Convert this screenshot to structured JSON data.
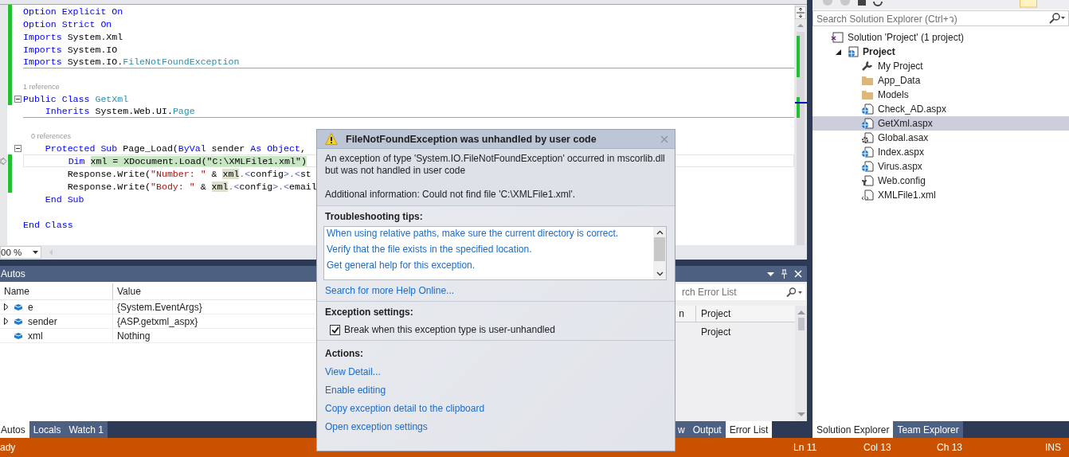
{
  "editor": {
    "lines": [
      {
        "kind": "code",
        "changed": true,
        "segments": [
          {
            "kind": "keyword",
            "text": "Option Explicit On"
          }
        ]
      },
      {
        "kind": "code",
        "changed": true,
        "segments": [
          {
            "kind": "keyword",
            "text": "Option Strict On"
          }
        ]
      },
      {
        "kind": "code",
        "changed": true,
        "segments": [
          {
            "kind": "keyword",
            "text": "Imports"
          },
          {
            "kind": "plain",
            "text": " System.Xml"
          }
        ]
      },
      {
        "kind": "code",
        "changed": true,
        "segments": [
          {
            "kind": "keyword",
            "text": "Imports"
          },
          {
            "kind": "plain",
            "text": " System.IO"
          }
        ]
      },
      {
        "kind": "code",
        "changed": true,
        "separator_below": true,
        "segments": [
          {
            "kind": "keyword",
            "text": "Imports"
          },
          {
            "kind": "plain",
            "text": " System.IO."
          },
          {
            "kind": "type",
            "text": "FileNotFoundException"
          }
        ]
      },
      {
        "kind": "blank",
        "changed": true
      },
      {
        "kind": "codelens",
        "changed": true,
        "text": "1 reference"
      },
      {
        "kind": "code",
        "changed": true,
        "collapsible": true,
        "segments": [
          {
            "kind": "keyword",
            "text": "Public Class "
          },
          {
            "kind": "type",
            "text": "GetXml"
          }
        ]
      },
      {
        "kind": "code",
        "separator_below": true,
        "segments": [
          {
            "kind": "keyword",
            "text": "    Inherits"
          },
          {
            "kind": "plain",
            "text": " System.Web.UI."
          },
          {
            "kind": "type",
            "text": "Page"
          }
        ]
      },
      {
        "kind": "blank"
      },
      {
        "kind": "codelens",
        "text": "    0 references"
      },
      {
        "kind": "code",
        "collapsible": true,
        "segments": [
          {
            "kind": "keyword",
            "text": "    Protected Sub"
          },
          {
            "kind": "plain",
            "text": " Page_Load("
          },
          {
            "kind": "keyword",
            "text": "ByVal"
          },
          {
            "kind": "plain",
            "text": " sender "
          },
          {
            "kind": "keyword",
            "text": "As Object"
          },
          {
            "kind": "plain",
            "text": ","
          }
        ]
      },
      {
        "kind": "code",
        "changed": true,
        "current": true,
        "segments": [
          {
            "kind": "keyword",
            "text": "        Dim "
          },
          {
            "kind": "current",
            "text": "xml = XDocument.Load(\"C:\\XMLFile1.xml\")"
          }
        ]
      },
      {
        "kind": "code",
        "changed": true,
        "segments": [
          {
            "kind": "plain",
            "text": "        Response.Write("
          },
          {
            "kind": "string",
            "text": "\"Number: \""
          },
          {
            "kind": "plain",
            "text": " & "
          },
          {
            "kind": "reference",
            "text": "xml"
          },
          {
            "kind": "xml",
            "text": ".<"
          },
          {
            "kind": "plain",
            "text": "config"
          },
          {
            "kind": "xml",
            "text": ">.<"
          },
          {
            "kind": "plain",
            "text": "st"
          }
        ]
      },
      {
        "kind": "code",
        "changed": true,
        "segments": [
          {
            "kind": "plain",
            "text": "        Response.Write("
          },
          {
            "kind": "string",
            "text": "\"Body: \""
          },
          {
            "kind": "plain",
            "text": " & "
          },
          {
            "kind": "reference",
            "text": "xml"
          },
          {
            "kind": "xml",
            "text": ".<"
          },
          {
            "kind": "plain",
            "text": "config"
          },
          {
            "kind": "xml",
            "text": ">.<"
          },
          {
            "kind": "plain",
            "text": "email"
          }
        ]
      },
      {
        "kind": "code",
        "segments": [
          {
            "kind": "keyword",
            "text": "    End Sub"
          }
        ]
      },
      {
        "kind": "blank"
      },
      {
        "kind": "code",
        "segments": [
          {
            "kind": "keyword",
            "text": "End Class"
          }
        ]
      }
    ],
    "zoom": "00 %"
  },
  "autos": {
    "title": "Autos",
    "columns": [
      "Name",
      "Value"
    ],
    "rows": [
      {
        "name": "e",
        "value": "{System.EventArgs}",
        "expandable": true
      },
      {
        "name": "sender",
        "value": "{ASP.getxml_aspx}",
        "expandable": true
      },
      {
        "name": "xml",
        "value": "Nothing",
        "expandable": false
      }
    ],
    "tabs": [
      {
        "label": "Autos",
        "selected": true
      },
      {
        "label": "Locals",
        "selected": false
      },
      {
        "label": "Watch 1",
        "selected": false
      }
    ]
  },
  "error_list": {
    "search": {
      "placeholder": "rch Error List"
    },
    "columns": [
      "n",
      "Project"
    ],
    "rows": [
      {
        "column_2": "Project"
      }
    ],
    "tabs": [
      {
        "label": "w",
        "selected": false
      },
      {
        "label": "Output",
        "selected": false
      },
      {
        "label": "Error List",
        "selected": true
      }
    ]
  },
  "solution_explorer": {
    "search": {
      "placeholder": "Search Solution Explorer (Ctrl+ว)"
    },
    "tree": [
      {
        "label": "Solution 'Project' (1 project)",
        "kind": "solution",
        "selected": false,
        "children": [
          {
            "label": "Project",
            "kind": "project",
            "expanded": true,
            "selected": false,
            "children": [
              {
                "label": "My Project",
                "kind": "settings",
                "selected": false
              },
              {
                "label": "App_Data",
                "kind": "folder",
                "selected": false
              },
              {
                "label": "Models",
                "kind": "folder",
                "selected": false
              },
              {
                "label": "Check_AD.aspx",
                "kind": "webpage",
                "selected": false
              },
              {
                "label": "GetXml.aspx",
                "kind": "webpage",
                "selected": true
              },
              {
                "label": "Global.asax",
                "kind": "gearpage",
                "selected": false
              },
              {
                "label": "Index.aspx",
                "kind": "webpage",
                "selected": false
              },
              {
                "label": "Virus.aspx",
                "kind": "webpage",
                "selected": false
              },
              {
                "label": "Web.config",
                "kind": "configpage",
                "selected": false
              },
              {
                "label": "XMLFile1.xml",
                "kind": "xmlpage",
                "selected": false
              }
            ]
          }
        ]
      }
    ],
    "tabs": [
      {
        "label": "Solution Explorer",
        "selected": true
      },
      {
        "label": "Team Explorer",
        "selected": false
      }
    ]
  },
  "exception_popup": {
    "title": "FileNotFoundException was unhandled by user code",
    "message": "An exception of type 'System.IO.FileNotFoundException' occurred in mscorlib.dll but was not handled in user code",
    "additional": "Additional information: Could not find file 'C:\\XMLFile1.xml'.",
    "tips_heading": "Troubleshooting tips:",
    "tips": [
      "When using relative paths, make sure the current directory is correct.",
      "Verify that the file exists in the specified location.",
      "Get general help for this exception."
    ],
    "search_link": "Search for more Help Online...",
    "settings_heading": "Exception settings:",
    "break_option": {
      "label": "Break when this exception type is user-unhandled",
      "checked": true
    },
    "actions_heading": "Actions:",
    "actions": [
      "View Detail...",
      "Enable editing",
      "Copy exception detail to the clipboard",
      "Open exception settings"
    ]
  },
  "status_bar": {
    "message": "ady",
    "line": "Ln 11",
    "column": "Col 13",
    "char": "Ch 13",
    "mode": "INS"
  }
}
